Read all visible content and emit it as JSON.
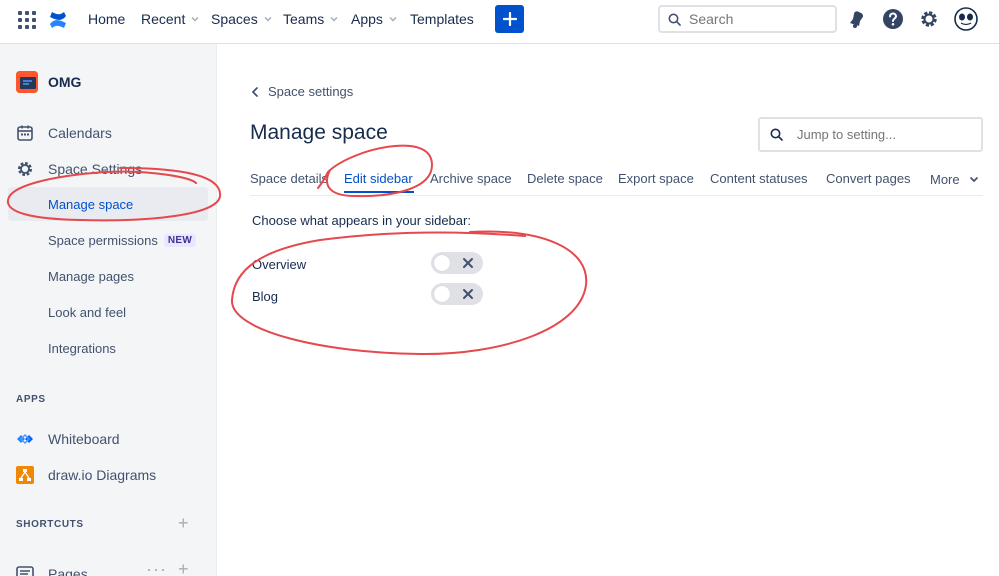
{
  "nav": {
    "items": [
      {
        "label": "Home",
        "dropdown": false
      },
      {
        "label": "Recent",
        "dropdown": true
      },
      {
        "label": "Spaces",
        "dropdown": true
      },
      {
        "label": "Teams",
        "dropdown": true
      },
      {
        "label": "Apps",
        "dropdown": true
      },
      {
        "label": "Templates",
        "dropdown": false
      }
    ],
    "search_placeholder": "Search",
    "icons": [
      "apps-grid-icon",
      "confluence-logo-icon",
      "plus-icon",
      "search-icon",
      "notification-icon",
      "help-icon",
      "settings-icon",
      "avatar"
    ]
  },
  "sidebar": {
    "space_name": "OMG",
    "items": [
      {
        "label": "Calendars",
        "icon": "calendar-icon"
      },
      {
        "label": "Space Settings",
        "icon": "gear-icon"
      }
    ],
    "settings_sub": [
      {
        "label": "Manage space",
        "active": true
      },
      {
        "label": "Space permissions",
        "badge": "NEW"
      },
      {
        "label": "Manage pages"
      },
      {
        "label": "Look and feel"
      },
      {
        "label": "Integrations"
      }
    ],
    "apps_heading": "APPS",
    "apps": [
      {
        "label": "Whiteboard",
        "icon": "whiteboard-icon"
      },
      {
        "label": "draw.io Diagrams",
        "icon": "drawio-icon"
      }
    ],
    "shortcuts_heading": "SHORTCUTS",
    "pages_label": "Pages"
  },
  "main": {
    "back_label": "Space settings",
    "title": "Manage space",
    "jump_placeholder": "Jump to setting...",
    "tabs": [
      {
        "label": "Space details"
      },
      {
        "label": "Edit sidebar",
        "active": true
      },
      {
        "label": "Archive space"
      },
      {
        "label": "Delete space"
      },
      {
        "label": "Export space"
      },
      {
        "label": "Content statuses"
      },
      {
        "label": "Convert pages"
      }
    ],
    "more_label": "More",
    "prompt": "Choose what appears in your sidebar:",
    "toggles": [
      {
        "label": "Overview",
        "on": false
      },
      {
        "label": "Blog",
        "on": false
      }
    ]
  },
  "colors": {
    "brand_blue": "#0052cc",
    "annotation_red": "#e5484d",
    "sidebar_bg": "#f4f5f7"
  }
}
